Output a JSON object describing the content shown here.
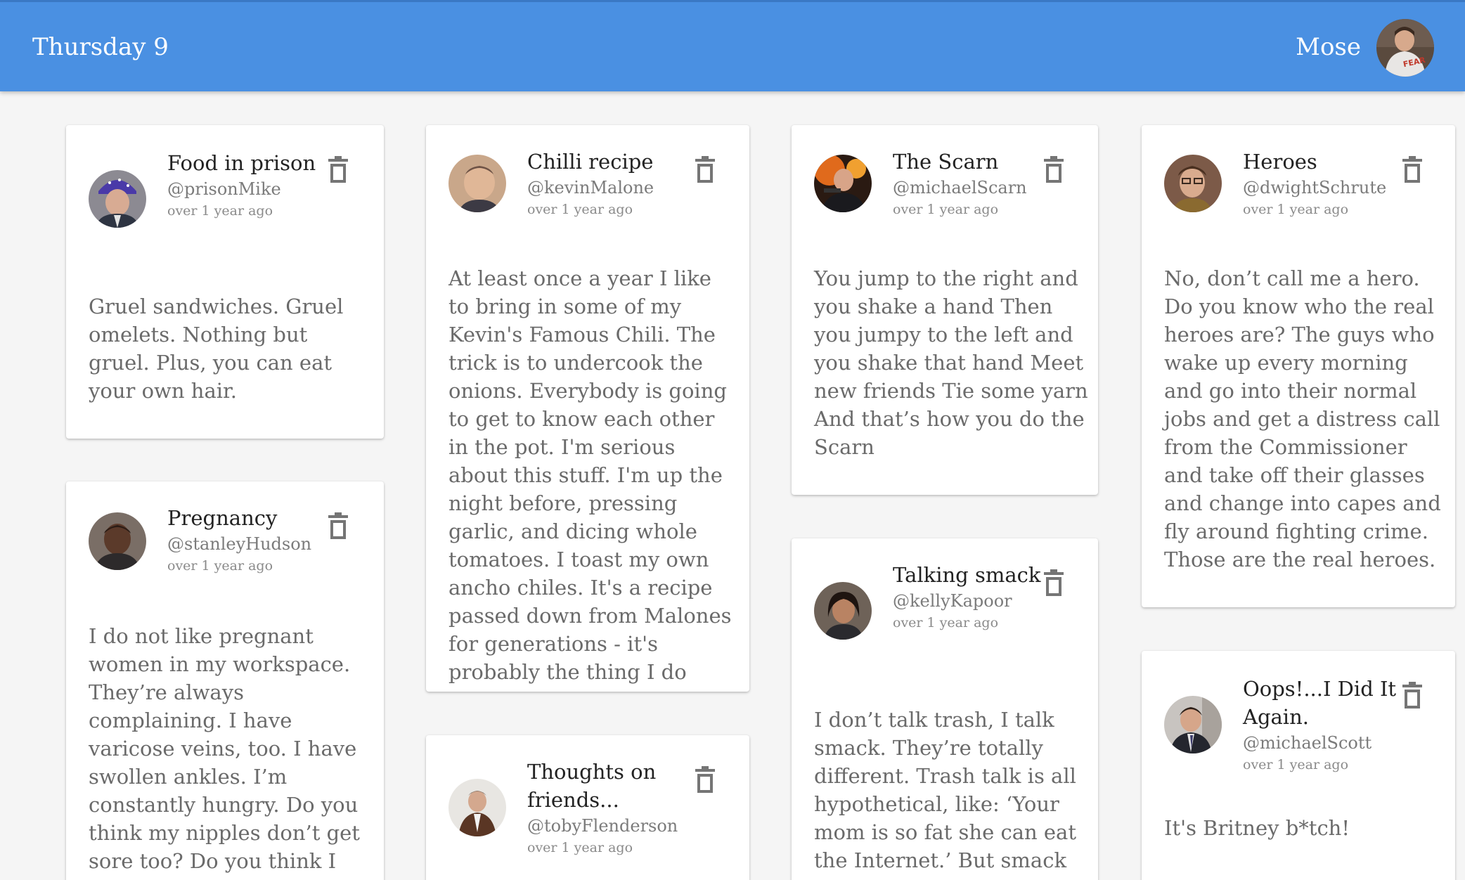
{
  "header": {
    "date": "Thursday 9",
    "user_name": "Mose",
    "user_avatar": "user-avatar"
  },
  "colors": {
    "header_bg": "#4a90e2",
    "card_bg": "#ffffff",
    "page_bg": "#f5f5f5"
  },
  "posts": [
    {
      "title": "Food in prison",
      "handle": "@prisonMike",
      "time": "over 1 year ago",
      "text": "Gruel sandwiches. Gruel omelets. Nothing but gruel. Plus, you can eat your own hair.",
      "icon": "trash-icon"
    },
    {
      "title": "Pregnancy",
      "handle": "@stanleyHudson",
      "time": "over 1 year ago",
      "text": "I do not like pregnant women in my workspace. They’re always complaining. I have varicose veins, too. I have swollen ankles. I’m constantly hungry. Do you think my nipples don’t get sore too? Do you think I",
      "icon": "trash-icon"
    },
    {
      "title": "Chilli recipe",
      "handle": "@kevinMalone",
      "time": "over 1 year ago",
      "text": "At least once a year I like to bring in some of my Kevin's Famous Chili. The trick is to undercook the onions. Everybody is going to get to know each other in the pot. I'm serious about this stuff. I'm up the night before, pressing garlic, and dicing whole tomatoes. I toast my own ancho chiles. It's a recipe passed down from Malones for generations - it's probably the thing I do best.\"",
      "icon": "trash-icon"
    },
    {
      "title": "Thoughts on friends...",
      "handle": "@tobyFlenderson",
      "time": "over 1 year ago",
      "text": "",
      "icon": "trash-icon"
    },
    {
      "title": "The Scarn",
      "handle": "@michaelScarn",
      "time": "over 1 year ago",
      "text": "You jump to the right and you shake a hand Then you jumpy to the left and you shake that hand Meet new friends Tie some yarn And that’s how you do the Scarn",
      "icon": "trash-icon"
    },
    {
      "title": "Talking smack",
      "handle": "@kellyKapoor",
      "time": "over 1 year ago",
      "text": "I don’t talk trash, I talk smack. They’re totally different. Trash talk is all hypothetical, like: ‘Your mom is so fat she can eat the Internet.’ But smack",
      "icon": "trash-icon"
    },
    {
      "title": "Heroes",
      "handle": "@dwightSchrute",
      "time": "over 1 year ago",
      "text": "No, don’t call me a hero. Do you know who the real heroes are? The guys who wake up every morning and go into their normal jobs and get a distress call from the Commissioner and take off their glasses and change into capes and fly around fighting crime. Those are the real heroes.",
      "icon": "trash-icon"
    },
    {
      "title": "Oops!...I Did It Again.",
      "handle": "@michaelScott",
      "time": "over 1 year ago",
      "text": "It's Britney b*tch!",
      "icon": "trash-icon"
    }
  ]
}
